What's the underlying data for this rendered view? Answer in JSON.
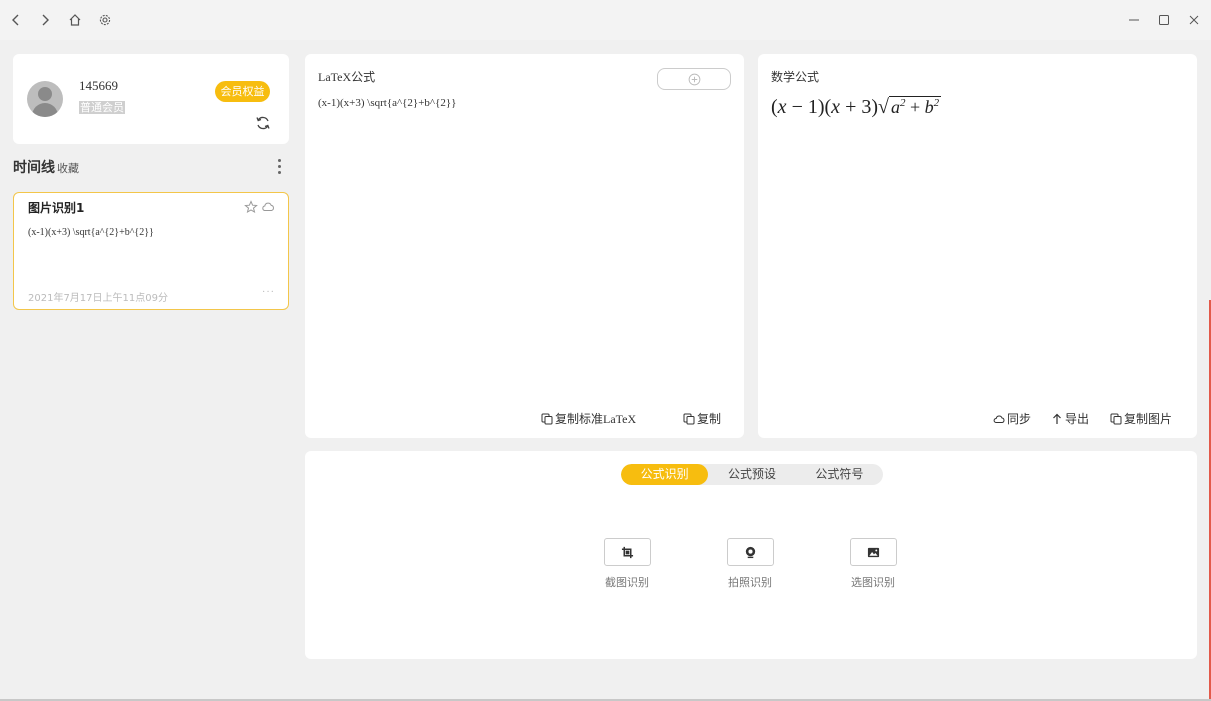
{
  "window": {
    "back_icon": "chevron-left-icon",
    "forward_icon": "chevron-right-icon",
    "home_icon": "home-icon",
    "settings_icon": "gear-icon",
    "minimize_icon": "minimize-icon",
    "maximize_icon": "maximize-icon",
    "close_icon": "close-icon"
  },
  "profile": {
    "user_id": "145669",
    "level": "普通会员",
    "vip_button": "会员权益",
    "refresh_icon": "refresh-icon"
  },
  "timeline": {
    "title": "时间线",
    "favorites_tab": "收藏",
    "items": [
      {
        "title": "图片识别1",
        "formula": "(x-1)(x+3) \\sqrt{a^{2}+b^{2}}",
        "date": "2021年7月17日上午11点09分",
        "more": "···"
      }
    ]
  },
  "latex_panel": {
    "title": "LaTeX公式",
    "content": "(x-1)(x+3) \\sqrt{a^{2}+b^{2}}",
    "copy_standard_label": "复制标准LaTeX",
    "copy_label": "复制"
  },
  "math_panel": {
    "title": "数学公式",
    "sync_label": "同步",
    "export_label": "导出",
    "copy_image_label": "复制图片"
  },
  "recognition": {
    "tabs": [
      "公式识别",
      "公式预设",
      "公式符号"
    ],
    "active_tab": "公式识别",
    "tools": [
      {
        "label": "截图识别",
        "icon": "crop-icon"
      },
      {
        "label": "拍照识别",
        "icon": "camera-icon"
      },
      {
        "label": "选图识别",
        "icon": "image-icon"
      }
    ]
  },
  "colors": {
    "accent": "#f7bd0f",
    "background": "#f0f0f0",
    "card": "#ffffff"
  }
}
